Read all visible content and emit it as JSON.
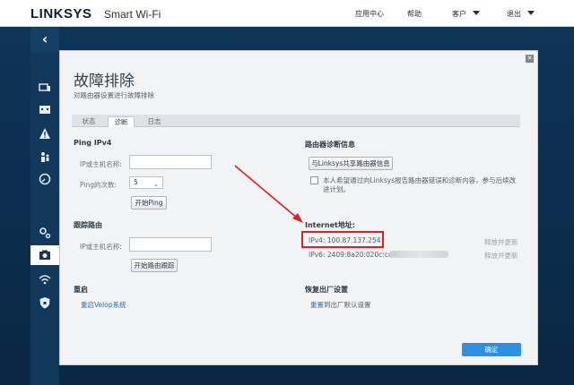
{
  "header": {
    "brand": "LINKSYS",
    "product": "Smart Wi-Fi",
    "nav": [
      {
        "label": "应用中心"
      },
      {
        "label": "帮助"
      },
      {
        "label": "客户"
      },
      {
        "label": "退出"
      }
    ]
  },
  "sidebar": {
    "items": [
      {
        "icon": "devices-icon"
      },
      {
        "icon": "toolbox-icon"
      },
      {
        "icon": "warning-icon"
      },
      {
        "icon": "parental-icon"
      },
      {
        "icon": "speed-icon"
      },
      {
        "icon": "settings-icon"
      },
      {
        "icon": "troubleshoot-icon",
        "active": true
      },
      {
        "icon": "wifi-icon"
      },
      {
        "icon": "security-icon"
      }
    ]
  },
  "page": {
    "title": "故障排除",
    "subtitle": "对路由器设置进行故障排除",
    "tabs": [
      {
        "label": "状态"
      },
      {
        "label": "诊断",
        "active": true
      },
      {
        "label": "日志"
      }
    ]
  },
  "ping": {
    "title": "Ping IPv4",
    "host_label": "IP或主机名称:",
    "host_value": "",
    "count_label": "Ping的次数:",
    "count_value": "5",
    "start_button": "开始Ping"
  },
  "trace": {
    "title": "跟踪路由",
    "host_label": "IP或主机名称:",
    "host_value": "",
    "start_button": "开始路由跟踪"
  },
  "reboot": {
    "title": "重启",
    "link": "重启Velop系统"
  },
  "diag": {
    "title": "路由器诊断信息",
    "share_button": "与Linksys共享路由器信息",
    "consent_line1": "本人希望通过向Linksys报告路由器错误和诊断内容，参与后续改",
    "consent_line2": "进计划。"
  },
  "internet": {
    "title": "Internet地址:",
    "ipv4": "IPv4: 100.87.137.254",
    "ipv6": "IPv6: 2409:8a20:020c:ce4",
    "release_ipv4": "释放并更新",
    "release_ipv6": "释放并更新"
  },
  "factory": {
    "title": "恢复出厂设置",
    "link_word": "重置",
    "link_rest": "到出厂默认设置"
  },
  "footer": {
    "ok_button": "确定"
  },
  "colors": {
    "accent": "#2f8fe0",
    "annotation_red": "#e02020",
    "background_blue": "#0b2c4c"
  }
}
